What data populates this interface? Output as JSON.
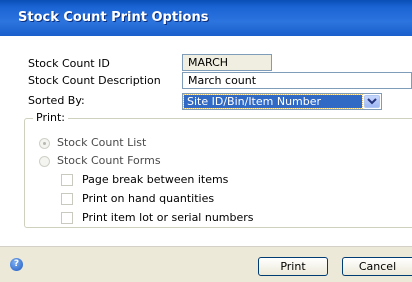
{
  "window": {
    "title": "Stock Count Print Options"
  },
  "form": {
    "stock_count_id_label": "Stock Count ID",
    "stock_count_id_value": "MARCH",
    "description_label": "Stock Count Description",
    "description_value": "March count",
    "sorted_by_label": "Sorted By:",
    "sorted_by_value": "Site ID/Bin/Item Number"
  },
  "print_group": {
    "legend": "Print:",
    "options": [
      {
        "label": "Stock Count List",
        "selected": true,
        "enabled": false
      },
      {
        "label": "Stock Count Forms",
        "selected": false,
        "enabled": false
      }
    ],
    "checkboxes": [
      {
        "label": "Page break between items",
        "checked": false
      },
      {
        "label": "Print on hand quantities",
        "checked": false
      },
      {
        "label": "Print item lot or serial numbers",
        "checked": false
      }
    ]
  },
  "footer": {
    "help_icon": "help-icon",
    "print_label": "Print",
    "cancel_label": "Cancel"
  },
  "colors": {
    "title_bar": "#1a64d4",
    "selection": "#316ac5"
  }
}
